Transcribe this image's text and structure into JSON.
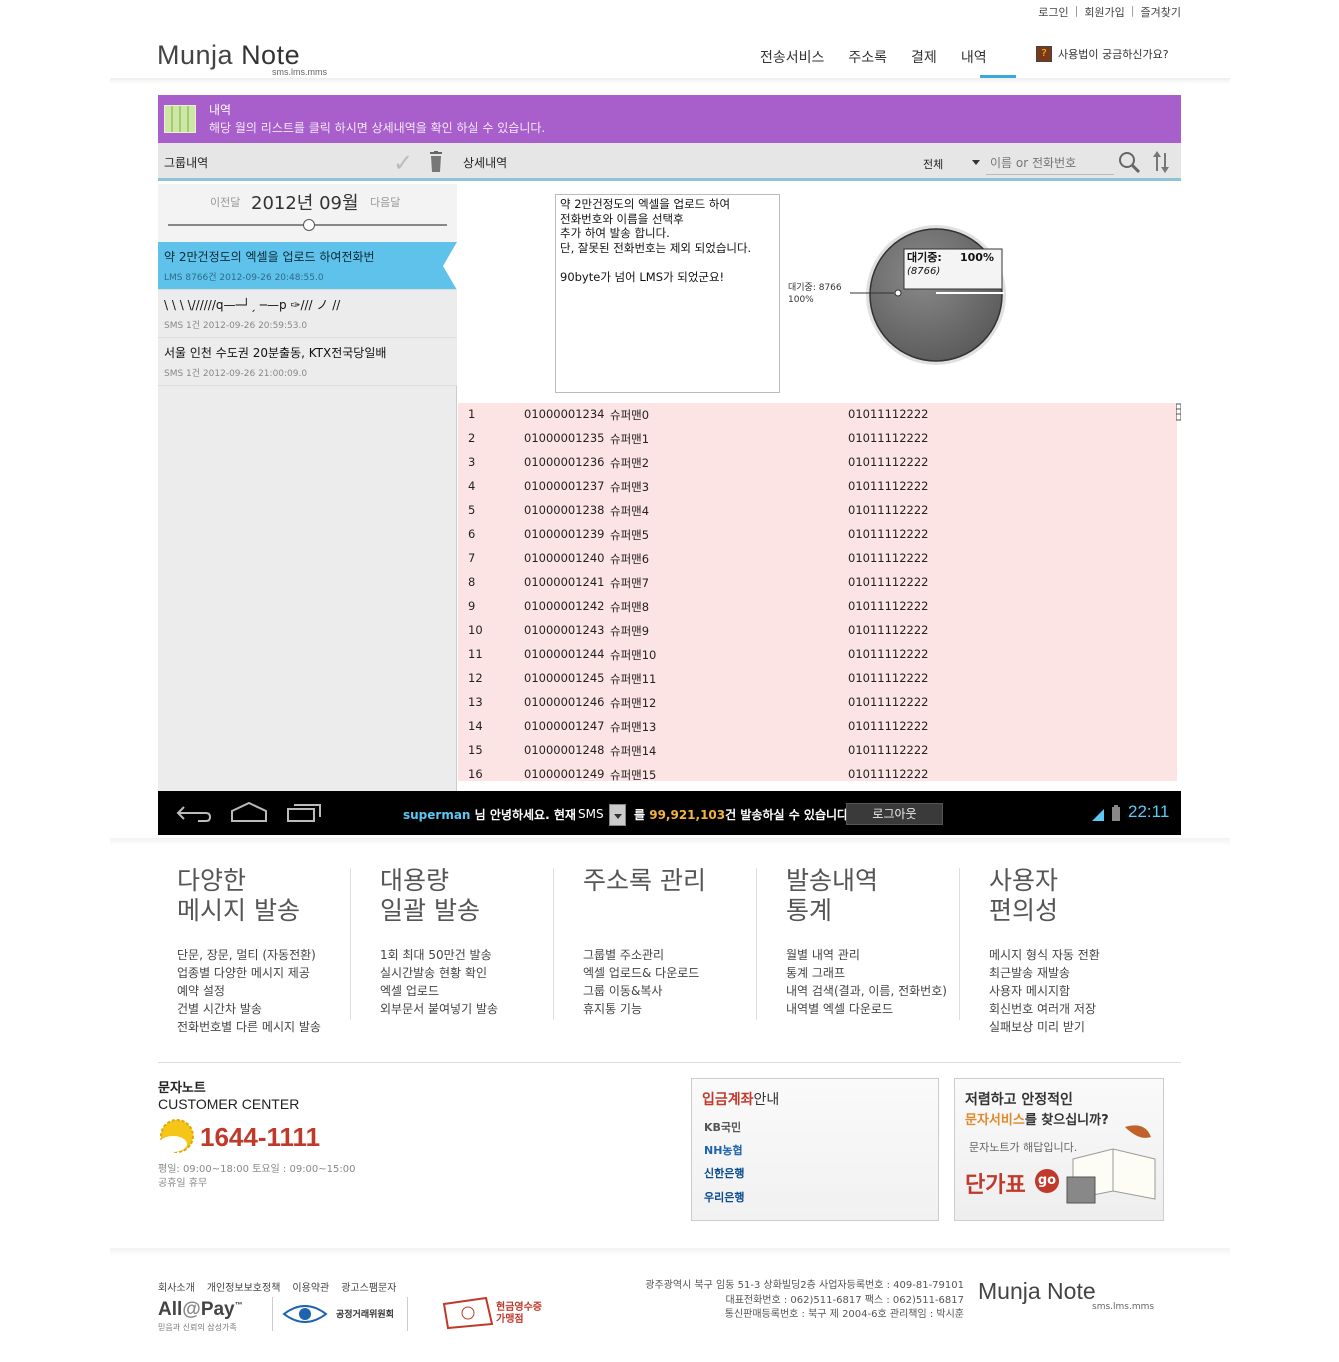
{
  "top_links": {
    "login": "로그인",
    "signup": "회원가입",
    "favorite": "즐겨찾기"
  },
  "header": {
    "logo_main": "Munja",
    "logo_bold": "Note",
    "logo_sub": "sms.lms.mms",
    "nav": [
      "전송서비스",
      "주소록",
      "결제",
      "내역"
    ],
    "help": "사용법이 궁금하신가요?"
  },
  "banner": {
    "title": "내역",
    "desc": "해당 월의 리스트를 클릭 하시면 상세내역을 확인 하실 수 있습니다."
  },
  "toolbar": {
    "group_label": "그룹내역",
    "detail_label": "상세내역",
    "filter_value": "전체",
    "search_placeholder": "이름 or 전화번호"
  },
  "month": {
    "prev": "이전달",
    "current": "2012년 09월",
    "next": "다음달"
  },
  "groups": [
    {
      "title": "약 2만건정도의 엑셀을 업로드 하여전화번",
      "meta": "LMS 8766건 2012-09-26 20:48:55.0"
    },
    {
      "title": "\\ \\ \\ \\//////q—─┘ˏ ─—p ✑/// ノ //",
      "meta": "SMS 1건 2012-09-26 20:59:53.0"
    },
    {
      "title": "서울 인천 수도권 20분출동, KTX전국당일배",
      "meta": "SMS 1건 2012-09-26 21:00:09.0"
    }
  ],
  "message": "약 2만건정도의 엑셀을 업로드 하여\n전화번호와 이름을 선택후\n추가 하여 발송 합니다.\n단, 잘못된 전화번호는 제외 되었습니다.\n\n90byte가 넘어 LMS가 되었군요!",
  "status": {
    "tooltip_label": "대기중:",
    "tooltip_pct": "100%",
    "tooltip_count": "(8766)",
    "side_label": "대기중: 8766",
    "side_pct": "100%",
    "pending_fraction": 1.0
  },
  "recipients": [
    {
      "no": "1",
      "phone": "01000001234",
      "name": "슈퍼맨0",
      "sender": "01011112222"
    },
    {
      "no": "2",
      "phone": "01000001235",
      "name": "슈퍼맨1",
      "sender": "01011112222"
    },
    {
      "no": "3",
      "phone": "01000001236",
      "name": "슈퍼맨2",
      "sender": "01011112222"
    },
    {
      "no": "4",
      "phone": "01000001237",
      "name": "슈퍼맨3",
      "sender": "01011112222"
    },
    {
      "no": "5",
      "phone": "01000001238",
      "name": "슈퍼맨4",
      "sender": "01011112222"
    },
    {
      "no": "6",
      "phone": "01000001239",
      "name": "슈퍼맨5",
      "sender": "01011112222"
    },
    {
      "no": "7",
      "phone": "01000001240",
      "name": "슈퍼맨6",
      "sender": "01011112222"
    },
    {
      "no": "8",
      "phone": "01000001241",
      "name": "슈퍼맨7",
      "sender": "01011112222"
    },
    {
      "no": "9",
      "phone": "01000001242",
      "name": "슈퍼맨8",
      "sender": "01011112222"
    },
    {
      "no": "10",
      "phone": "01000001243",
      "name": "슈퍼맨9",
      "sender": "01011112222"
    },
    {
      "no": "11",
      "phone": "01000001244",
      "name": "슈퍼맨10",
      "sender": "01011112222"
    },
    {
      "no": "12",
      "phone": "01000001245",
      "name": "슈퍼맨11",
      "sender": "01011112222"
    },
    {
      "no": "13",
      "phone": "01000001246",
      "name": "슈퍼맨12",
      "sender": "01011112222"
    },
    {
      "no": "14",
      "phone": "01000001247",
      "name": "슈퍼맨13",
      "sender": "01011112222"
    },
    {
      "no": "15",
      "phone": "01000001248",
      "name": "슈퍼맨14",
      "sender": "01011112222"
    },
    {
      "no": "16",
      "phone": "01000001249",
      "name": "슈퍼맨15",
      "sender": "01011112222"
    }
  ],
  "statusbar": {
    "user": "superman",
    "greet": " 님 안녕하세요. 현재",
    "type": "SMS",
    "remain_pre": "를 ",
    "remain_num": "99,921,103",
    "remain_post": "건 발송하실 수 있습니다.",
    "logout": "로그아웃",
    "time": "22:11"
  },
  "features": [
    {
      "heading": "다양한\n메시지 발송",
      "items": [
        "단문, 장문, 멀티 (자동전환)",
        "업종별 다양한 메시지 제공",
        "예약 설정",
        "건별 시간차 발송",
        "전화번호별 다른 메시지 발송"
      ]
    },
    {
      "heading": "대용량\n일괄 발송",
      "items": [
        "1회 최대 50만건 발송",
        "실시간발송 현황 확인",
        "엑셀 업로드",
        "외부문서 붙여넣기 발송"
      ]
    },
    {
      "heading": "주소록 관리",
      "items": [
        "그룹별 주소관리",
        "엑셀 업로드& 다운로드",
        "그룹 이동&복사",
        "휴지통 기능"
      ]
    },
    {
      "heading": "발송내역\n통계",
      "items": [
        "월별 내역 관리",
        "통계 그래프",
        "내역 검색(결과, 이름, 전화번호)",
        "내역별 엑셀 다운로드"
      ]
    },
    {
      "heading": "사용자\n편의성",
      "items": [
        "메시지 형식 자동 전환",
        "최근발송 재발송",
        "사용자 메시지함",
        "회신번호 여러개 저장",
        "실패보상 미리 받기"
      ]
    }
  ],
  "customer": {
    "name": "문자노트",
    "center": "CUSTOMER CENTER",
    "phone": "1644-1111",
    "hours1": "평일: 09:00~18:00 토요일 : 09:00~15:00",
    "hours2": "공휴일 휴무"
  },
  "bank": {
    "title_red": "입금계좌",
    "title_rest": "안내",
    "banks": [
      "KB국민",
      "NH농협",
      "신한은행",
      "우리은행"
    ]
  },
  "price": {
    "line1": "저렴하고 안정적인",
    "line2_red": "문자서비스",
    "line2_rest": "를 찾으십니까?",
    "line3": "문자노트가 해답입니다.",
    "line4": "단가표",
    "go": "go"
  },
  "footer": {
    "links": [
      "회사소개",
      "개인정보보호정책",
      "이용약관",
      "광고스팸문자"
    ],
    "allpay_a": "All",
    "allpay_at": "@",
    "allpay_b": "Pay",
    "allpay_tm": "™",
    "allpay_sub": "믿음과 신뢰의 삼성가족",
    "ftc": "공정거래위원회",
    "cash1": "현금영수증",
    "cash2": "가맹점",
    "addr1": "광주광역시 북구 임동 51-3 상화빌딩2층 사업자등록번호 : 409-81-79101",
    "addr2": "대표전화번호 : 062)511-6817 팩스 : 062)511-6817",
    "addr3": "통신판매등록번호 : 북구 제 2004-6호 관리책임 : 박시훈",
    "logo_main": "Munja",
    "logo_bold": "Note",
    "logo_sub": "sms.lms.mms"
  },
  "colors": {
    "banner": "#a85fcc",
    "selected": "#5ec2ea",
    "table_bg": "#fce4e4",
    "accent": "#3aa8d8"
  }
}
